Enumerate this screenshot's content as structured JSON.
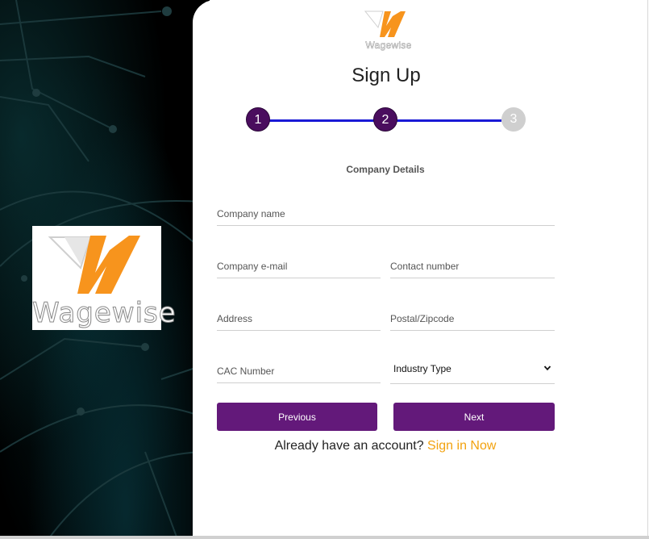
{
  "brand": {
    "name": "Wagewise",
    "colors": {
      "accent_orange": "#f7941d",
      "purple": "#63197a",
      "step_line": "#1a1ad6"
    }
  },
  "page": {
    "title": "Sign Up"
  },
  "stepper": {
    "steps": [
      {
        "label": "1",
        "state": "completed"
      },
      {
        "label": "2",
        "state": "active"
      },
      {
        "label": "3",
        "state": "pending"
      }
    ]
  },
  "form": {
    "section_title": "Company Details",
    "fields": {
      "company_name": {
        "placeholder": "Company name",
        "value": ""
      },
      "company_email": {
        "placeholder": "Company e-mail",
        "value": ""
      },
      "contact_number": {
        "placeholder": "Contact number",
        "value": ""
      },
      "address": {
        "placeholder": "Address",
        "value": ""
      },
      "postal_code": {
        "placeholder": "Postal/Zipcode",
        "value": ""
      },
      "cac_number": {
        "placeholder": "CAC Number",
        "value": ""
      },
      "industry_type": {
        "selected": "Industry Type"
      }
    },
    "previous_label": "Previous",
    "next_label": "Next"
  },
  "signin": {
    "prompt": "Already have an account?",
    "link": "Sign in Now"
  }
}
